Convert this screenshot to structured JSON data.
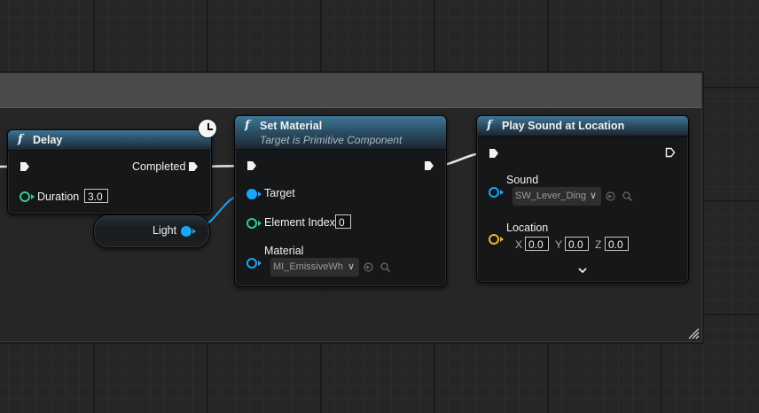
{
  "colors": {
    "object_pin": "#1ba6f5",
    "integer_pin": "#2fd090",
    "vector_pin": "#f0b82a",
    "exec_wire": "#e8e8e8",
    "function_header": "#2b5068"
  },
  "nodes": {
    "delay": {
      "icon": "function-icon",
      "title": "Delay",
      "output_label": "Completed",
      "duration_label": "Duration",
      "duration_value": "3.0",
      "latent_icon": "clock-icon"
    },
    "light": {
      "label": "Light"
    },
    "set_material": {
      "icon": "function-icon",
      "title": "Set Material",
      "subtitle": "Target is Primitive Component",
      "target_label": "Target",
      "element_index_label": "Element Index",
      "element_index_value": "0",
      "material_label": "Material",
      "material_value": "MI_EmissiveWh"
    },
    "play_sound": {
      "icon": "function-icon",
      "title": "Play Sound at Location",
      "sound_label": "Sound",
      "sound_value": "SW_Lever_Ding",
      "location_label": "Location",
      "x_label": "X",
      "x_value": "0.0",
      "y_label": "Y",
      "y_value": "0.0",
      "z_label": "Z",
      "z_value": "0.0",
      "expand_icon": "chevron-down-icon"
    }
  }
}
